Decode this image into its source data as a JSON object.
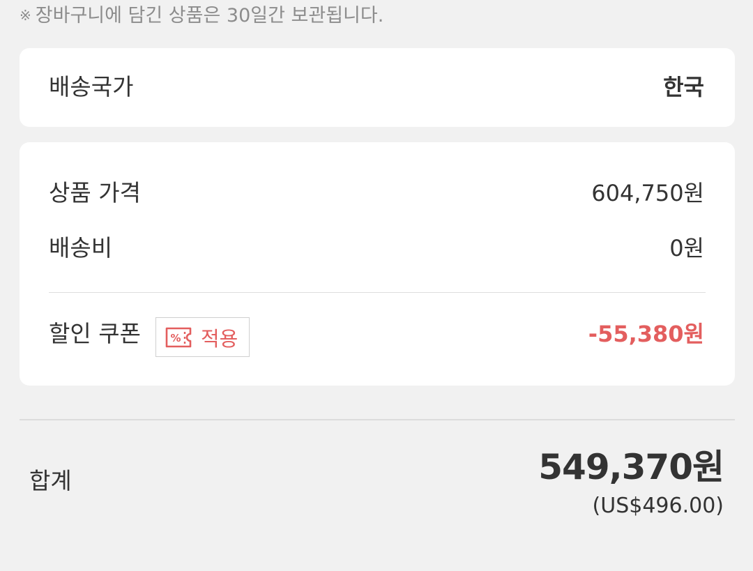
{
  "notice": {
    "mark": "※",
    "text": "장바구니에 담긴 상품은 30일간 보관됩니다."
  },
  "shipping_country": {
    "label": "배송국가",
    "value": "한국"
  },
  "price_summary": {
    "product_price": {
      "label": "상품 가격",
      "value": "604,750원"
    },
    "shipping_fee": {
      "label": "배송비",
      "value": "0원"
    },
    "discount_coupon": {
      "label": "할인 쿠폰",
      "button_label": "적용",
      "button_icon": "coupon-percent-icon",
      "amount": "-55,380",
      "unit": "원"
    }
  },
  "total": {
    "label": "합계",
    "value": "549,370원",
    "usd": "(US$496.00)"
  },
  "colors": {
    "background": "#f1f1f1",
    "card": "#ffffff",
    "accent_red": "#e35e5e",
    "notice_gray": "#8c8c8c",
    "text": "#333333"
  }
}
